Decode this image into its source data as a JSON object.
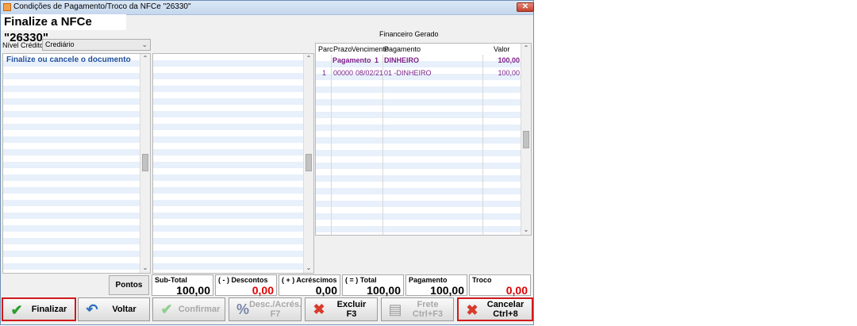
{
  "window": {
    "title": "Condições de Pagamento/Troco da NFCe \"26330\"",
    "close_glyph": "✕"
  },
  "header": {
    "title": "Finalize a NFCe \"26330\""
  },
  "credit": {
    "label": "Nível Crédito",
    "value": "Crediário"
  },
  "document_list": {
    "message": "Finalize ou cancele o documento"
  },
  "financeiro": {
    "title": "Financeiro Gerado",
    "columns": {
      "parc": "Parc",
      "prazo": "Prazo",
      "vencimento": "Vencimento",
      "pagamento": "Pagamento",
      "valor": "Valor"
    },
    "summary": {
      "label": "Pagamento",
      "count": "1",
      "name": "DINHEIRO",
      "valor": "100,00"
    },
    "rows": [
      {
        "parc": "1",
        "prazo": "00000",
        "vencimento": "08/02/21",
        "pagamento": "01 -DINHEIRO",
        "valor": "100,00"
      }
    ]
  },
  "totals": {
    "pontos_label": "Pontos",
    "subtotal": {
      "label": "Sub-Total",
      "value": "100,00"
    },
    "descontos": {
      "label": "( - ) Descontos",
      "value": "0,00"
    },
    "acrescimos": {
      "label": "( + ) Acréscimos",
      "value": "0,00"
    },
    "total": {
      "label": "( = ) Total",
      "value": "100,00"
    },
    "pagamento": {
      "label": "Pagamento",
      "value": "100,00"
    },
    "troco": {
      "label": "Troco",
      "value": "0,00"
    }
  },
  "buttons": {
    "finalizar": "Finalizar",
    "voltar": "Voltar",
    "confirmar": "Confirmar",
    "desc_acres": "Desc./Acrés.\nF7",
    "excluir": "Excluir\nF3",
    "frete": "Frete\nCtrl+F3",
    "cancelar": "Cancelar\nCtrl+8"
  },
  "colors": {
    "accent_red": "#d21919",
    "value_red": "#e00000",
    "purple_text": "#7a1f86",
    "row_alt": "#e7f0fb"
  }
}
